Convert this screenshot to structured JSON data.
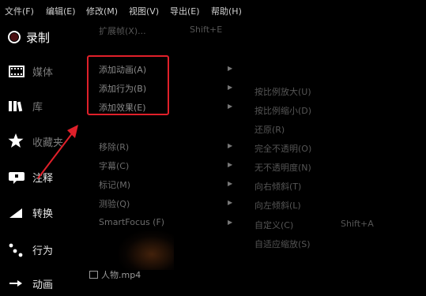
{
  "menubar": {
    "items": [
      "文件(F)",
      "编辑(E)",
      "修改(M)",
      "视图(V)",
      "导出(E)",
      "帮助(H)"
    ]
  },
  "sidebar": {
    "record": "录制",
    "items": [
      {
        "label": "媒体",
        "icon": "film-icon"
      },
      {
        "label": "库",
        "icon": "library-icon"
      },
      {
        "label": "收藏夹",
        "icon": "star-icon"
      },
      {
        "label": "注释",
        "icon": "annotation-icon"
      },
      {
        "label": "转换",
        "icon": "transition-icon"
      },
      {
        "label": "行为",
        "icon": "behavior-icon"
      },
      {
        "label": "动画",
        "icon": "animation-icon"
      }
    ]
  },
  "menu": {
    "top_item": {
      "label": "扩展帧(X)...",
      "shortcut": "Shift+E"
    },
    "highlighted": [
      "添加动画(A)",
      "添加行为(B)",
      "添加效果(E)"
    ],
    "lower": [
      "移除(R)",
      "字幕(C)",
      "标记(M)",
      "测验(Q)",
      "SmartFocus (F)"
    ]
  },
  "submenu": {
    "items": [
      {
        "label": "按比例放大(U)"
      },
      {
        "label": "按比例缩小(D)"
      },
      {
        "label": "还原(R)"
      },
      {
        "label": "完全不透明(O)"
      },
      {
        "label": "无不透明度(N)"
      },
      {
        "label": "向右倾斜(T)"
      },
      {
        "label": "向左倾斜(L)"
      },
      {
        "label": "自定义(C)",
        "shortcut": "Shift+A"
      },
      {
        "label": "自适应缩放(S)"
      }
    ]
  },
  "file": {
    "name": "人物.mp4"
  },
  "colors": {
    "highlight": "#e0202a",
    "arrow": "#e0202a",
    "background": "#000000"
  }
}
